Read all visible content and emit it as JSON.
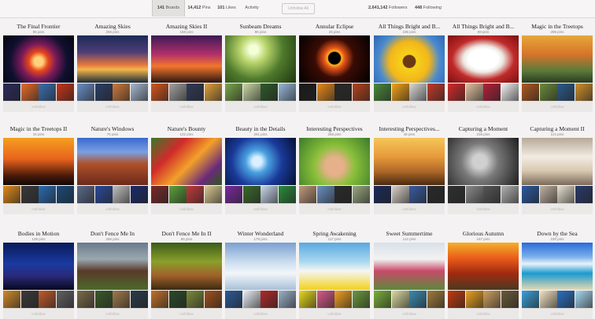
{
  "header": {
    "tabs": [
      {
        "count": "141",
        "label": "Boards",
        "active": true
      },
      {
        "count": "14,412",
        "label": "Pins"
      },
      {
        "count": "101",
        "label": "Likes"
      },
      {
        "label": "Activity"
      }
    ],
    "unfollow_all": "Unfollow All",
    "followers_count": "2,641,142",
    "followers_label": "Followers",
    "following_count": "448",
    "following_label": "Following"
  },
  "board_action": "Unfollow",
  "boards": [
    {
      "title": "The Final Frontier",
      "pins": "96 pins",
      "art": "nebula"
    },
    {
      "title": "Amazing Skies",
      "pins": "256 pins",
      "art": "sky"
    },
    {
      "title": "Amazing Skies II",
      "pins": "158 pins",
      "art": "sunset"
    },
    {
      "title": "Sunbeam Dreams",
      "pins": "86 pins",
      "art": "sunbeam"
    },
    {
      "title": "Annular Eclipse",
      "pins": "26 pins",
      "art": "eclipse"
    },
    {
      "title": "All Things Bright and B...",
      "pins": "236 pins",
      "art": "butterfly"
    },
    {
      "title": "All Things Bright and B...",
      "pins": "69 pins",
      "art": "puppy"
    },
    {
      "title": "Magic in the Treetops",
      "pins": "286 pins",
      "art": "autumn"
    },
    {
      "title": "Magic in the Treetops II",
      "pins": "15 pins",
      "art": "tree-sunset"
    },
    {
      "title": "Nature's Windows",
      "pins": "76 pins",
      "art": "arch"
    },
    {
      "title": "Nature's Bounty",
      "pins": "122 pins",
      "art": "vegetables"
    },
    {
      "title": "Beauty in the Details",
      "pins": "261 pins",
      "art": "flower-blue"
    },
    {
      "title": "Interesting Perspectives",
      "pins": "266 pins",
      "art": "hands"
    },
    {
      "title": "Interesting Perspectives...",
      "pins": "46 pins",
      "art": "desert"
    },
    {
      "title": "Capturing a Moment",
      "pins": "218 pins",
      "art": "bw"
    },
    {
      "title": "Capturing a Moment II",
      "pins": "114 pins",
      "art": "wedding"
    },
    {
      "title": "Bodies in Motion",
      "pins": "139 pins",
      "art": "dance"
    },
    {
      "title": "Don't Fence Me In",
      "pins": "266 pins",
      "art": "barn"
    },
    {
      "title": "Don't Fence Me In II",
      "pins": "65 pins",
      "art": "forest-path"
    },
    {
      "title": "Winter Wonderland",
      "pins": "179 pins",
      "art": "snow"
    },
    {
      "title": "Spring Awakening",
      "pins": "117 pins",
      "art": "lamb"
    },
    {
      "title": "Sweet Summertime",
      "pins": "112 pins",
      "art": "summer"
    },
    {
      "title": "Glorious Autumn",
      "pins": "167 pins",
      "art": "autumn2"
    },
    {
      "title": "Down by the Sea",
      "pins": "230 pins",
      "art": "sea"
    }
  ]
}
